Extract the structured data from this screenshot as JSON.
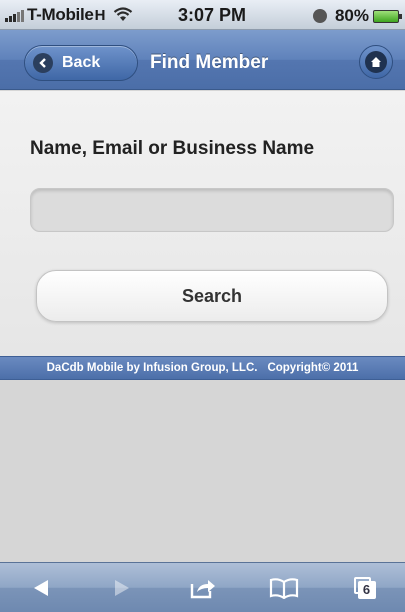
{
  "status_bar": {
    "carrier": "T-Mobile",
    "network": "H",
    "time": "3:07 PM",
    "battery": "80%"
  },
  "header": {
    "back_label": "Back",
    "title": "Find Member"
  },
  "form": {
    "label": "Name, Email or Business Name",
    "input_value": "",
    "button_label": "Search"
  },
  "footer": {
    "left": "DaCdb Mobile by Infusion Group, LLC.",
    "right": "Copyright© 2011"
  },
  "toolbar": {
    "tab_count": "6"
  },
  "colors": {
    "header": "#5f82bb",
    "footer": "#5a7db6",
    "content_bg": "#eeeeee"
  },
  "icons": [
    "back-arrow-icon",
    "home-icon",
    "safari-back-icon",
    "safari-forward-icon",
    "share-icon",
    "bookmarks-icon",
    "tabs-icon",
    "wifi-icon",
    "battery-icon",
    "signal-icon",
    "alarm-icon"
  ]
}
